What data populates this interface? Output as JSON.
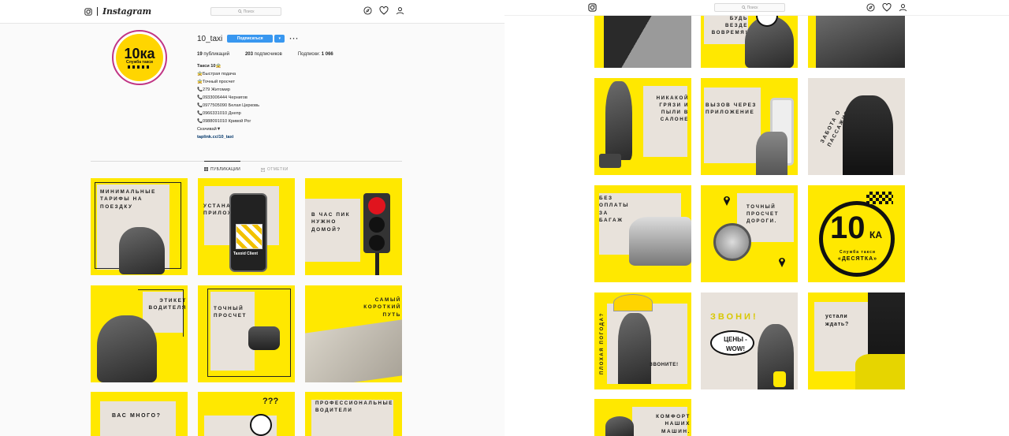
{
  "left": {
    "nav": {
      "wordmark": "Instagram",
      "search_placeholder": "Поиск"
    },
    "profile": {
      "username": "10_taxi",
      "follow_label": "Подписаться",
      "dropdown_label": "▾",
      "more_label": "···",
      "avatar": {
        "big": "10ка",
        "sub": "Служба такси"
      },
      "stats": {
        "posts_count": "19",
        "posts_label": "публикаций",
        "followers_count": "203",
        "followers_label": "подписчиков",
        "following_label": "Подписки:",
        "following_count": "1 066"
      },
      "bio": {
        "name": "Такси 10🚖",
        "lines": [
          "🚖Быстрая подача",
          "🚖Точный просчет",
          "📞279 Житомир",
          "📞0933006444 Чернигов",
          "📞0977505090 Белая Церковь",
          "📞0966331010 Днепр",
          "📞0988091010 Кривой Рог",
          "Скачивай▼"
        ],
        "link": "taplink.cc/10_taxi"
      },
      "tabs": {
        "posts": "ПУБЛИКАЦИИ",
        "tagged": "ОТМЕТКИ"
      }
    },
    "posts": [
      "минимальные тарифы на поездку",
      "устанавливай приложение",
      "в час пик нужно домой?",
      "этикет водителя",
      "точный просчет",
      "самый короткий путь",
      "вас много?",
      "???",
      "профессиональные водители"
    ],
    "post_extra": {
      "app_name": "Taxoid Client"
    }
  },
  "right": {
    "nav": {
      "search_placeholder": "Поиск"
    },
    "posts": [
      "",
      "",
      "будь везде вовремя!",
      "",
      "никакой грязи и пыли в салоне",
      "вызов через приложение",
      "забота о пассажире",
      "без оплаты за багаж",
      "точный просчет дороги.",
      "10ка",
      "плохая погода?",
      "звоните!",
      "звони!",
      "цены - wow!",
      "устали ждать?",
      "комфорт наших машин."
    ],
    "logo_tile": {
      "big": "10",
      "ka": "КА",
      "sub": "Служба такси",
      "name": "«ДЕСЯТКА»"
    }
  },
  "colors": {
    "brand_yellow": "#ffe800",
    "follow_blue": "#3897f0",
    "card": "#e8e2db"
  }
}
